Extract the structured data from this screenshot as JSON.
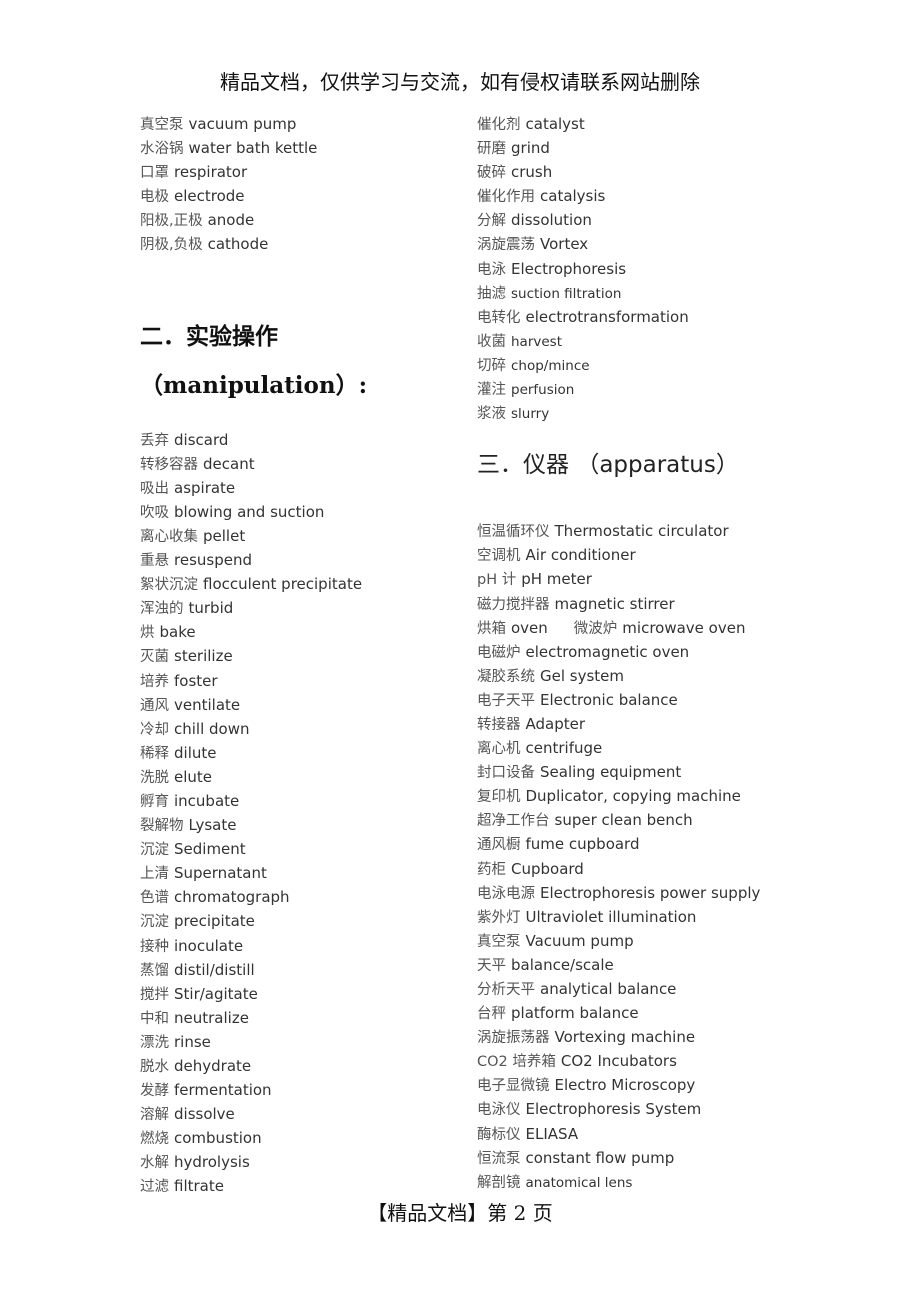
{
  "header": {
    "text": "精品文档，仅供学习与交流，如有侵权请联系网站删除"
  },
  "footer": {
    "text": "【精品文档】第 2 页"
  },
  "left_top": [
    {
      "zh": "真空泵",
      "en": "vacuum pump"
    },
    {
      "zh": "水浴锅",
      "en": "water bath kettle"
    },
    {
      "zh": "口罩",
      "en": "respirator"
    },
    {
      "zh": "电极",
      "en": "electrode"
    },
    {
      "zh": "阳极,正极",
      "en": "anode"
    },
    {
      "zh": "阴极,负极",
      "en": "cathode"
    }
  ],
  "section2": {
    "title_zh": "二．实验操作",
    "title_en": "（manipulation）:",
    "items": [
      {
        "zh": "丢弃",
        "en": "discard"
      },
      {
        "zh": "转移容器",
        "en": "decant"
      },
      {
        "zh": "吸出",
        "en": "aspirate"
      },
      {
        "zh": "吹吸",
        "en": "blowing and suction"
      },
      {
        "zh": "离心收集",
        "en": "pellet"
      },
      {
        "zh": "重悬",
        "en": "resuspend"
      },
      {
        "zh": "絮状沉淀",
        "en": "flocculent precipitate"
      },
      {
        "zh": "浑浊的",
        "en": "turbid"
      },
      {
        "zh": "烘",
        "en": "bake"
      },
      {
        "zh": "灭菌",
        "en": "sterilize"
      },
      {
        "zh": "培养",
        "en": "foster"
      },
      {
        "zh": "通风",
        "en": "ventilate"
      },
      {
        "zh": "冷却",
        "en": "chill down"
      },
      {
        "zh": "稀释",
        "en": "dilute"
      },
      {
        "zh": "洗脱",
        "en": "elute"
      },
      {
        "zh": "孵育",
        "en": "incubate"
      },
      {
        "zh": "裂解物",
        "en": "Lysate"
      },
      {
        "zh": "沉淀",
        "en": "Sediment"
      },
      {
        "zh": "上清",
        "en": "Supernatant"
      },
      {
        "zh": "色谱",
        "en": "chromatograph"
      },
      {
        "zh": "沉淀",
        "en": "precipitate"
      },
      {
        "zh": "接种",
        "en": "inoculate"
      },
      {
        "zh": "蒸馏",
        "en": "distil/distill"
      },
      {
        "zh": "搅拌",
        "en": "Stir/agitate"
      },
      {
        "zh": "中和",
        "en": "neutralize"
      },
      {
        "zh": "漂洗",
        "en": "rinse"
      },
      {
        "zh": "脱水",
        "en": "dehydrate"
      },
      {
        "zh": "发酵",
        "en": "fermentation"
      },
      {
        "zh": "溶解",
        "en": "dissolve"
      },
      {
        "zh": "燃烧",
        "en": "combustion"
      },
      {
        "zh": "水解",
        "en": "hydrolysis"
      },
      {
        "zh": "过滤",
        "en": "filtrate"
      }
    ]
  },
  "right_top": [
    {
      "zh": "催化剂",
      "en": "catalyst"
    },
    {
      "zh": "研磨",
      "en": "grind"
    },
    {
      "zh": "破碎",
      "en": "crush"
    },
    {
      "zh": "催化作用",
      "en": "catalysis"
    },
    {
      "zh": "分解",
      "en": "dissolution"
    },
    {
      "zh": "涡旋震荡",
      "en": "Vortex"
    },
    {
      "zh": "电泳",
      "en": "Electrophoresis"
    },
    {
      "zh": "抽滤",
      "en": "suction filtration"
    },
    {
      "zh": "电转化",
      "en": "electrotransformation"
    },
    {
      "zh": "收菌",
      "en": "harvest"
    },
    {
      "zh": "切碎",
      "en": "chop/mince"
    },
    {
      "zh": "灌注",
      "en": "perfusion"
    },
    {
      "zh": "浆液",
      "en": "slurry"
    }
  ],
  "section3": {
    "title_num": "三．",
    "title_zh": "仪器",
    "title_en": "（apparatus）",
    "items": [
      {
        "zh": "恒温循环仪",
        "en": "Thermostatic circulator"
      },
      {
        "zh": "空调机",
        "en": "Air conditioner"
      },
      {
        "zh": "pH 计",
        "en": "pH meter"
      },
      {
        "zh": "磁力搅拌器",
        "en": "magnetic stirrer"
      },
      {
        "zh": "烘箱",
        "en": "oven",
        "zh2": "微波炉",
        "en2": "microwave oven"
      },
      {
        "zh": "电磁炉",
        "en": "electromagnetic oven"
      },
      {
        "zh": "凝胶系统",
        "en": "Gel system"
      },
      {
        "zh": "电子天平",
        "en": "Electronic balance"
      },
      {
        "zh": "转接器",
        "en": "Adapter"
      },
      {
        "zh": "离心机",
        "en": "centrifuge"
      },
      {
        "zh": "封口设备",
        "en": "Sealing equipment"
      },
      {
        "zh": "复印机",
        "en": "Duplicator, copying machine"
      },
      {
        "zh": "超净工作台",
        "en": "super clean bench"
      },
      {
        "zh": "通风橱",
        "en": "fume cupboard"
      },
      {
        "zh": "药柜",
        "en": "Cupboard"
      },
      {
        "zh": "电泳电源",
        "en": "Electrophoresis power supply"
      },
      {
        "zh": "紫外灯",
        "en": "Ultraviolet illumination"
      },
      {
        "zh": "真空泵",
        "en": "Vacuum pump"
      },
      {
        "zh": "天平",
        "en": "balance/scale"
      },
      {
        "zh": "分析天平",
        "en": "analytical balance"
      },
      {
        "zh": "台秤",
        "en": "platform balance"
      },
      {
        "zh": "涡旋振荡器",
        "en": "Vortexing machine"
      },
      {
        "zh": "CO2 培养箱",
        "en": "CO2 Incubators"
      },
      {
        "zh": "电子显微镜",
        "en": "Electro Microscopy"
      },
      {
        "zh": "电泳仪",
        "en": "Electrophoresis System"
      },
      {
        "zh": "酶标仪",
        "en": "ELIASA"
      },
      {
        "zh": "恒流泵",
        "en": "constant flow pump"
      },
      {
        "zh": "解剖镜",
        "en": "anatomical lens"
      }
    ]
  }
}
